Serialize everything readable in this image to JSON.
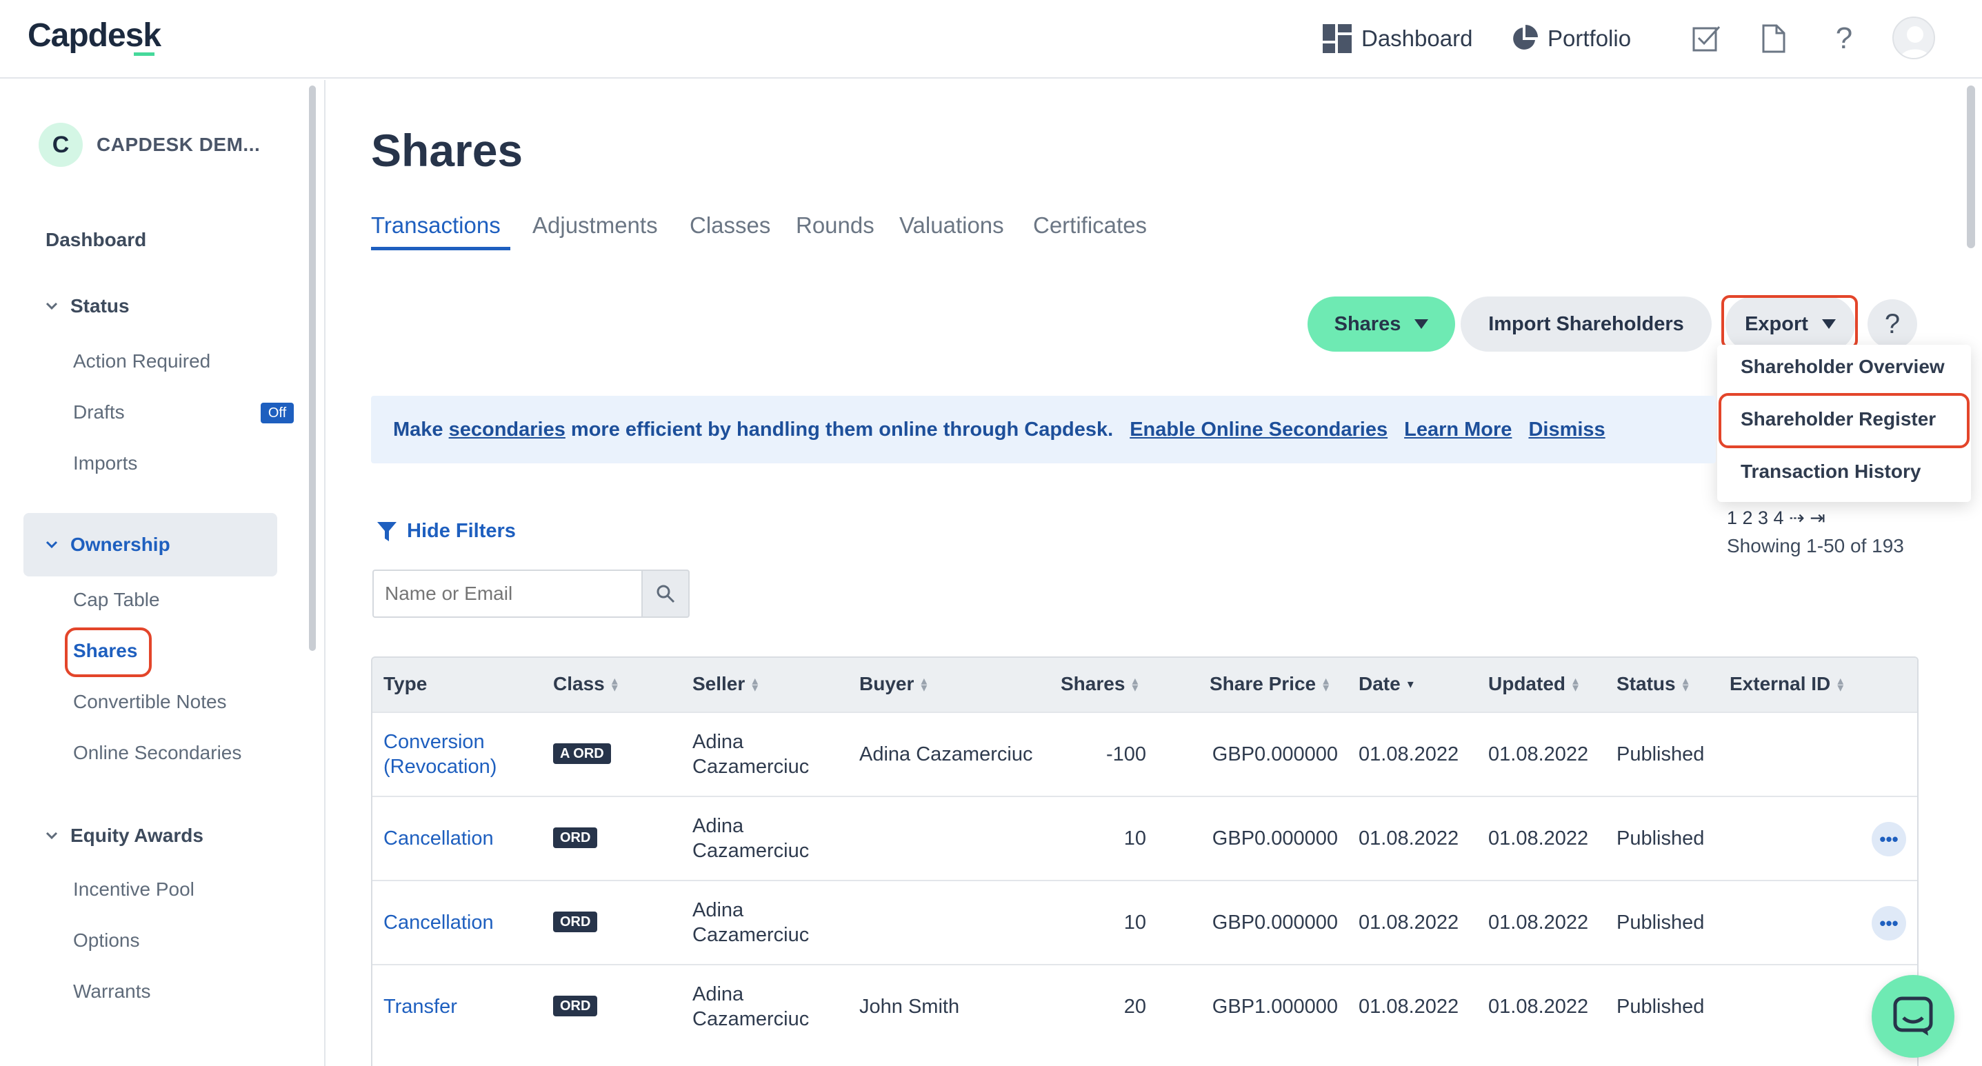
{
  "app": {
    "logo": "Capdesk",
    "brand_color": "#46d99b",
    "accent_color": "#1e5fbf",
    "highlight_color": "#e3452a"
  },
  "topnav": {
    "dashboard": "Dashboard",
    "portfolio": "Portfolio",
    "icons": [
      "dashboard-grid-icon",
      "pie-chart-icon",
      "checkbox-icon",
      "document-icon",
      "help-icon",
      "user-avatar"
    ]
  },
  "sidebar": {
    "org_initial": "C",
    "org_name": "CAPDESK DEM...",
    "dashboard": "Dashboard",
    "status": {
      "label": "Status",
      "items": [
        "Action Required",
        "Drafts",
        "Imports"
      ],
      "drafts_badge": "Off"
    },
    "ownership": {
      "label": "Ownership",
      "items": [
        "Cap Table",
        "Shares",
        "Convertible Notes",
        "Online Secondaries"
      ]
    },
    "equity_awards": {
      "label": "Equity Awards",
      "items": [
        "Incentive Pool",
        "Options",
        "Warrants"
      ]
    }
  },
  "page": {
    "title": "Shares",
    "tabs": [
      "Transactions",
      "Adjustments",
      "Classes",
      "Rounds",
      "Valuations",
      "Certificates"
    ],
    "active_tab": "Transactions"
  },
  "toolbar": {
    "shares": "Shares",
    "import": "Import Shareholders",
    "export": "Export",
    "help": "?"
  },
  "export_menu": [
    "Shareholder Overview",
    "Shareholder Register",
    "Transaction History"
  ],
  "banner": {
    "text1": "Make ",
    "link1": "secondaries",
    "text2": " more efficient by handling them online through Capdesk.",
    "enable": "Enable Online Secondaries",
    "learn": "Learn More",
    "dismiss": "Dismiss"
  },
  "filters": {
    "hide": "Hide Filters",
    "search_placeholder": "Name or Email"
  },
  "pagination": {
    "pages": "1 2 3 4",
    "next": "⇢",
    "last": "⇥",
    "showing": "Showing 1-50 of 193"
  },
  "table": {
    "headers": [
      "Type",
      "Class",
      "Seller",
      "Buyer",
      "Shares",
      "Share Price",
      "Date",
      "Updated",
      "Status",
      "External ID"
    ],
    "rows": [
      {
        "type1": "Conversion",
        "type2": "(Revocation)",
        "class": "A ORD",
        "seller1": "Adina",
        "seller2": "Cazamerciuc",
        "buyer": "Adina Cazamerciuc",
        "shares": "-100",
        "price": "GBP0.000000",
        "date": "01.08.2022",
        "updated": "01.08.2022",
        "status": "Published"
      },
      {
        "type1": "Cancellation",
        "type2": "",
        "class": "ORD",
        "seller1": "Adina",
        "seller2": "Cazamerciuc",
        "buyer": "",
        "shares": "10",
        "price": "GBP0.000000",
        "date": "01.08.2022",
        "updated": "01.08.2022",
        "status": "Published"
      },
      {
        "type1": "Cancellation",
        "type2": "",
        "class": "ORD",
        "seller1": "Adina",
        "seller2": "Cazamerciuc",
        "buyer": "",
        "shares": "10",
        "price": "GBP0.000000",
        "date": "01.08.2022",
        "updated": "01.08.2022",
        "status": "Published"
      },
      {
        "type1": "Transfer",
        "type2": "",
        "class": "ORD",
        "seller1": "Adina",
        "seller2": "Cazamerciuc",
        "buyer": "John Smith",
        "shares": "20",
        "price": "GBP1.000000",
        "date": "01.08.2022",
        "updated": "01.08.2022",
        "status": "Published"
      }
    ],
    "more_label": "•••"
  }
}
